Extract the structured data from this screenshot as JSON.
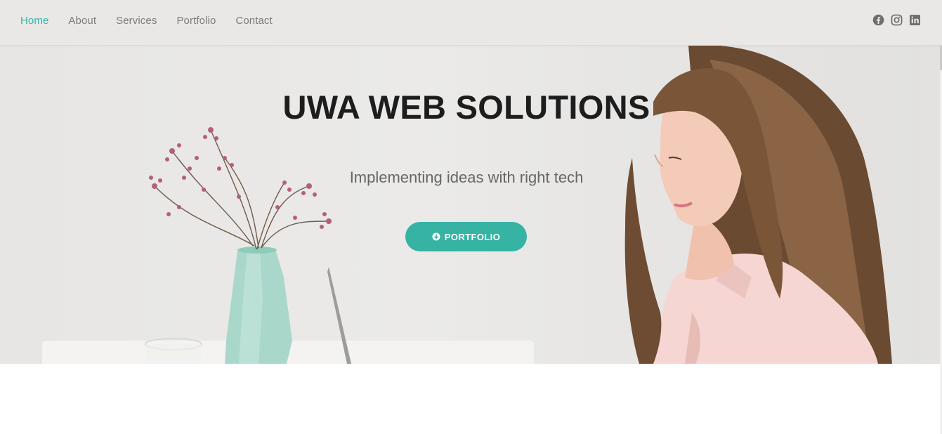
{
  "nav": {
    "items": [
      {
        "label": "Home",
        "active": true
      },
      {
        "label": "About",
        "active": false
      },
      {
        "label": "Services",
        "active": false
      },
      {
        "label": "Portfolio",
        "active": false
      },
      {
        "label": "Contact",
        "active": false
      }
    ],
    "social": [
      "facebook-icon",
      "instagram-icon",
      "linkedin-icon"
    ]
  },
  "hero": {
    "title": "UWA WEB SOLUTIONS",
    "subtitle": "Implementing ideas with right tech",
    "cta_label": "PORTFOLIO",
    "cta_icon": "arrow-circle-down-icon"
  },
  "colors": {
    "accent": "#36b3a3",
    "nav_bg": "#e9e8e6",
    "text_dark": "#1d1d1d",
    "text_muted": "#7c7c7c"
  }
}
